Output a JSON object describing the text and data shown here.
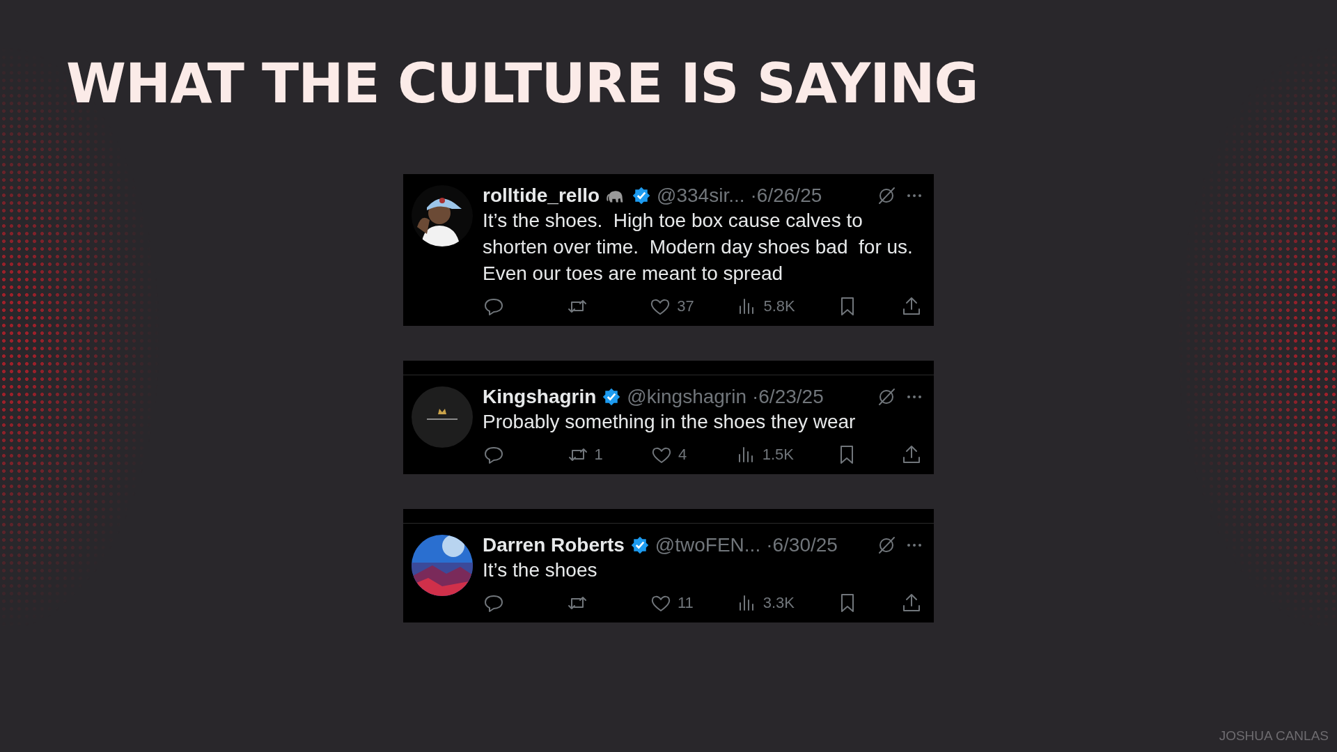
{
  "slide": {
    "title": "WHAT THE CULTURE IS SAYING",
    "credit": "JOSHUA CANLAS"
  },
  "tweets": [
    {
      "divider_above": false,
      "name": "rolltide_rello",
      "name_badge": true,
      "verified": true,
      "handle": "@334sir...",
      "date": "·6/26/25",
      "text": "It’s the shoes.  High toe box cause calves to shorten over time.  Modern day shoes bad  for us. Even our toes are meant to spread",
      "likes": "37",
      "views": "5.8K"
    },
    {
      "divider_above": true,
      "name": "Kingshagrin",
      "name_badge": false,
      "verified": true,
      "handle": "@kingshagrin",
      "date": "·6/23/25",
      "text": "Probably something in the shoes they wear",
      "retweets": "1",
      "likes": "4",
      "views": "1.5K"
    },
    {
      "divider_above": true,
      "name": "Darren Roberts",
      "name_badge": false,
      "verified": true,
      "handle": "@twoFEN...",
      "date": "·6/30/25",
      "text": "It’s the shoes",
      "likes": "11",
      "views": "3.3K"
    }
  ]
}
